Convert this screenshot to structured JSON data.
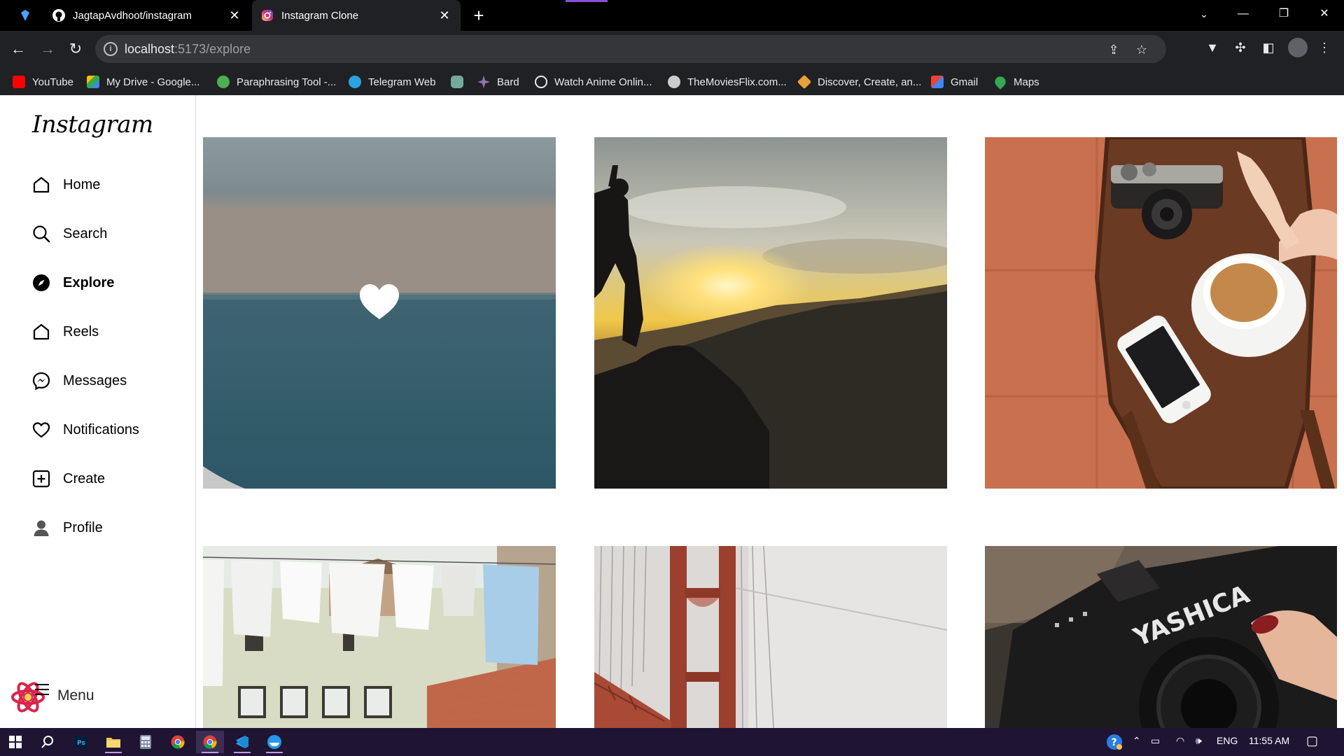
{
  "browser": {
    "tabs": [
      {
        "title": "JagtapAvdhoot/instagram",
        "icon": "github-icon"
      },
      {
        "title": "Instagram Clone",
        "icon": "instagram-icon",
        "active": true
      }
    ],
    "url_host": "localhost",
    "url_path": ":5173/explore",
    "bookmarks": [
      {
        "label": "YouTube",
        "color": "#ff0000"
      },
      {
        "label": "My Drive - Google...",
        "color": "#fbbc04"
      },
      {
        "label": "Paraphrasing Tool -...",
        "color": "#4caf50"
      },
      {
        "label": "Telegram Web",
        "color": "#2aa3e0"
      },
      {
        "label": "",
        "color": "#74aa9c"
      },
      {
        "label": "Bard",
        "color": "#8e75ff"
      },
      {
        "label": "Watch Anime Onlin...",
        "color": "#ffffff"
      },
      {
        "label": "TheMoviesFlix.com...",
        "color": "#cccccc"
      },
      {
        "label": "Discover, Create, an...",
        "color": "#e9a23b"
      },
      {
        "label": "Gmail",
        "color": "#ea4335"
      },
      {
        "label": "Maps",
        "color": "#34a853"
      }
    ]
  },
  "app": {
    "logo": "Instagram",
    "nav": [
      {
        "label": "Home",
        "icon": "home-icon"
      },
      {
        "label": "Search",
        "icon": "search-icon"
      },
      {
        "label": "Explore",
        "icon": "explore-icon",
        "active": true
      },
      {
        "label": "Reels",
        "icon": "reels-icon"
      },
      {
        "label": "Messages",
        "icon": "messages-icon"
      },
      {
        "label": "Notifications",
        "icon": "heart-icon"
      },
      {
        "label": "Create",
        "icon": "create-icon"
      },
      {
        "label": "Profile",
        "icon": "profile-icon"
      }
    ],
    "menu_label": "Menu",
    "explore_grid": [
      {
        "subject": "ocean-horizon",
        "hovered": true
      },
      {
        "subject": "climber-sunset"
      },
      {
        "subject": "camera-tea-phone"
      },
      {
        "subject": "laundry-building"
      },
      {
        "subject": "golden-gate-bridge"
      },
      {
        "subject": "yashica-camera"
      }
    ],
    "photo_text": "YASHICA"
  },
  "taskbar": {
    "lang": "ENG",
    "time": "11:55 AM"
  }
}
